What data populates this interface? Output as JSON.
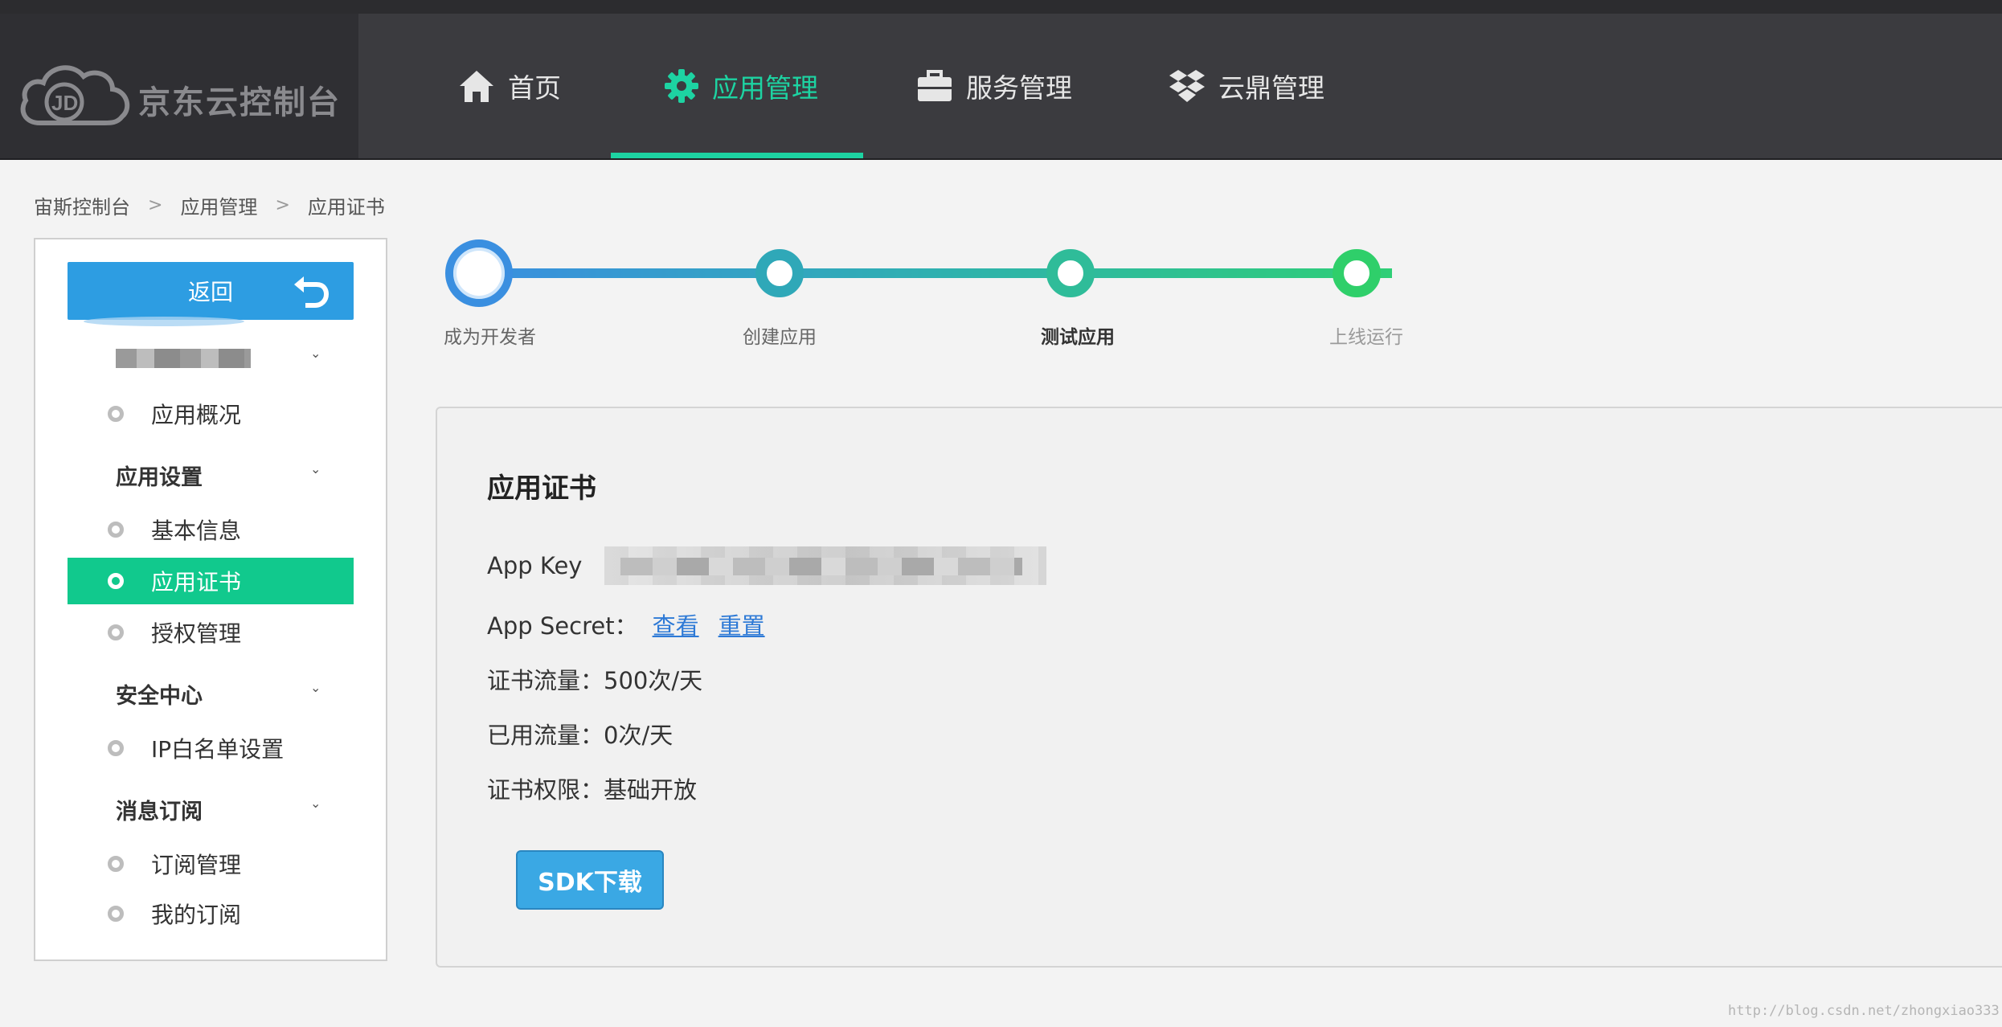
{
  "header": {
    "logo_text": "京东云控制台",
    "nav": [
      {
        "label": "首页",
        "icon": "home-icon"
      },
      {
        "label": "应用管理",
        "icon": "gear-icon",
        "active": true
      },
      {
        "label": "服务管理",
        "icon": "briefcase-icon"
      },
      {
        "label": "云鼎管理",
        "icon": "dropbox-icon"
      }
    ]
  },
  "breadcrumb": [
    "宙斯控制台",
    "应用管理",
    "应用证书"
  ],
  "sidebar": {
    "back_label": "返回",
    "overview": "应用概况",
    "groups": [
      {
        "title": "应用设置",
        "items": [
          "基本信息",
          "应用证书",
          "授权管理"
        ]
      },
      {
        "title": "安全中心",
        "items": [
          "IP白名单设置"
        ]
      },
      {
        "title": "消息订阅",
        "items": [
          "订阅管理",
          "我的订阅"
        ]
      }
    ],
    "active_item": "应用证书"
  },
  "steps": [
    {
      "label": "成为开发者",
      "state": "done"
    },
    {
      "label": "创建应用",
      "state": "done"
    },
    {
      "label": "测试应用",
      "state": "current"
    },
    {
      "label": "上线运行",
      "state": "future"
    }
  ],
  "card": {
    "title": "应用证书",
    "app_key_label": "App Key",
    "app_secret_label": "App Secret：",
    "view_link": "查看",
    "reset_link": "重置",
    "quota_row": "证书流量：500次/天",
    "used_row": "已用流量：0次/天",
    "permission_row": "证书权限：基础开放",
    "sdk_button": "SDK下载"
  },
  "watermark": "http://blog.csdn.net/zhongxiao333",
  "colors": {
    "header_bg": "#3b3b3f",
    "accent_green": "#1dd3a2",
    "primary_blue": "#2d9de2",
    "active_menu_bg": "#11c98d",
    "link_blue": "#2e7ad6"
  }
}
